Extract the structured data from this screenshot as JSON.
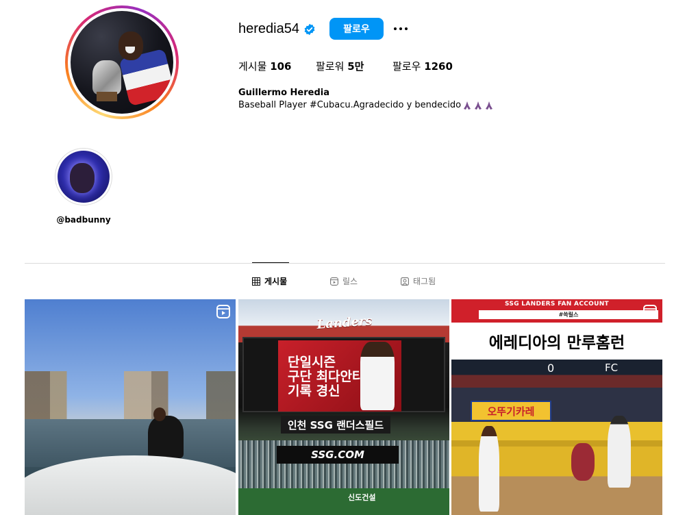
{
  "profile": {
    "username": "heredia54",
    "follow_label": "팔로우",
    "stats": {
      "posts_label": "게시물",
      "posts_value": "106",
      "followers_label": "팔로워",
      "followers_value": "5만",
      "following_label": "팔로우",
      "following_value": "1260"
    },
    "full_name": "Guillermo Heredia",
    "bio": "Baseball Player #Cubacu.Agradecido y bendecido"
  },
  "highlights": [
    {
      "label": "@badbunny"
    }
  ],
  "tabs": [
    {
      "label": "게시물",
      "icon": "grid-icon",
      "active": true
    },
    {
      "label": "릴스",
      "icon": "reels-icon",
      "active": false
    },
    {
      "label": "태그됨",
      "icon": "tagged-icon",
      "active": false
    }
  ],
  "posts": {
    "tile2": {
      "logo": "Landers",
      "headline_1": "단일시즌",
      "headline_2": "구단 최다안타",
      "headline_3": "기록 경신",
      "sign": "인천 SSG 랜더스필드",
      "ad": "SSG.COM",
      "ad2": "신도건설"
    },
    "tile3": {
      "banner": "SSG LANDERS FAN ACCOUNT",
      "tag": "#쓱릴스",
      "title": "에레디아의 만루홈런",
      "sponsor": "오뚜기카레",
      "score": "0",
      "team": "FC"
    }
  },
  "colors": {
    "accent": "#0095f6",
    "divider": "#dbdbdb",
    "verified": "#0095f6"
  }
}
